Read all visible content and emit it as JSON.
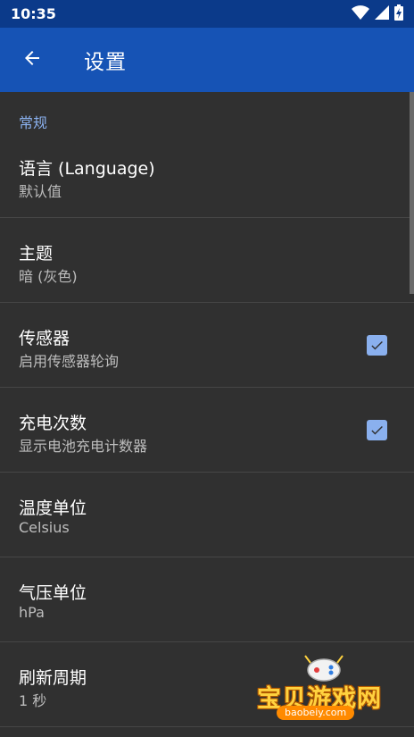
{
  "status_bar": {
    "time": "10:35",
    "icons": [
      "wifi-icon",
      "signal-icon",
      "battery-charging-icon"
    ]
  },
  "toolbar": {
    "back_icon": "arrow-left-icon",
    "title": "设置"
  },
  "section": {
    "title": "常规"
  },
  "preferences": [
    {
      "title": "语言 (Language)",
      "summary": "默认值",
      "checkbox": false
    },
    {
      "title": "主题",
      "summary": "暗 (灰色)",
      "checkbox": false
    },
    {
      "title": "传感器",
      "summary": "启用传感器轮询",
      "checkbox": true,
      "checked": true
    },
    {
      "title": "充电次数",
      "summary": "显示电池充电计数器",
      "checkbox": true,
      "checked": true
    },
    {
      "title": "温度单位",
      "summary": "Celsius",
      "checkbox": false
    },
    {
      "title": "气压单位",
      "summary": "hPa",
      "checkbox": false
    },
    {
      "title": "刷新周期",
      "summary": "1 秒",
      "checkbox": false
    }
  ],
  "watermark": {
    "text": "宝贝游戏网",
    "subtext": "baobeiy.com"
  },
  "colors": {
    "status_bar": "#0b3a8a",
    "toolbar": "#1653b5",
    "background": "#303030",
    "accent": "#8ab0ee",
    "divider": "#464646"
  }
}
